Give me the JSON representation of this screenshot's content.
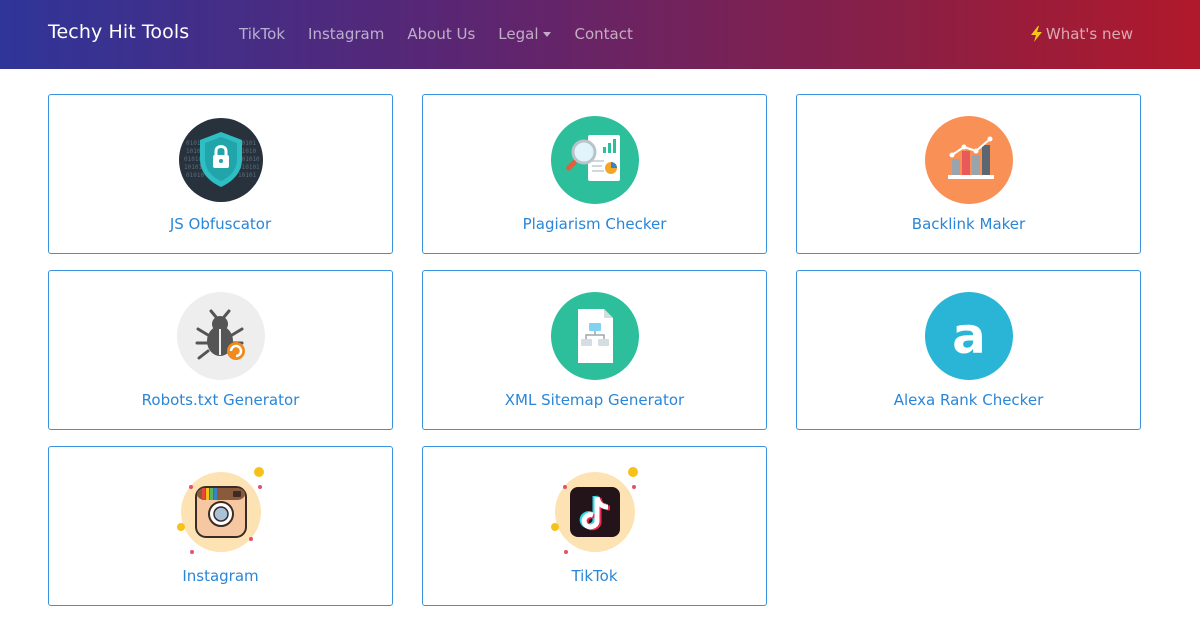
{
  "navbar": {
    "brand": "Techy Hit Tools",
    "links": [
      "TikTok",
      "Instagram",
      "About Us",
      "Legal",
      "Contact"
    ],
    "whats_new": "What's new",
    "colors": {
      "gradient_start": "#2f3599",
      "gradient_end": "#b0192b",
      "bolt": "#f5c518"
    }
  },
  "tools": [
    {
      "label": "JS Obfuscator",
      "icon": "shield-lock-icon"
    },
    {
      "label": "Plagiarism Checker",
      "icon": "magnifier-report-icon"
    },
    {
      "label": "Backlink Maker",
      "icon": "bar-chart-icon"
    },
    {
      "label": "Robots.txt Generator",
      "icon": "bug-icon"
    },
    {
      "label": "XML Sitemap Generator",
      "icon": "sitemap-file-icon"
    },
    {
      "label": "Alexa Rank Checker",
      "icon": "alexa-icon"
    },
    {
      "label": "Instagram",
      "icon": "instagram-icon"
    },
    {
      "label": "TikTok",
      "icon": "tiktok-icon"
    }
  ],
  "colors": {
    "card_border": "#3a93e0",
    "card_label": "#2a86d8"
  }
}
